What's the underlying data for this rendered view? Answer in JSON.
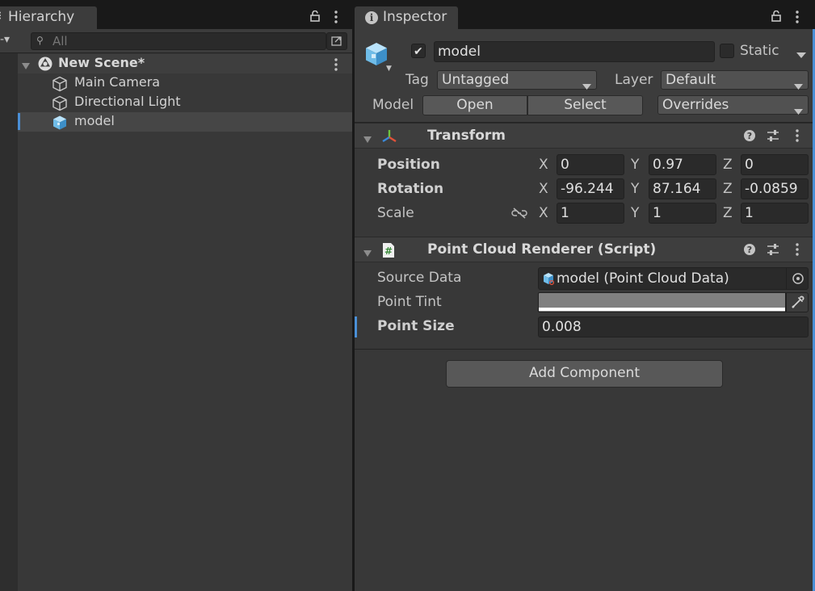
{
  "hierarchy": {
    "tab_label": "Hierarchy",
    "search_placeholder": "All",
    "scene": {
      "name": "New Scene*"
    },
    "objects": [
      {
        "label": "Main Camera",
        "icon": "gameobject-icon"
      },
      {
        "label": "Directional Light",
        "icon": "gameobject-icon"
      },
      {
        "label": "model",
        "icon": "prefab-model-icon",
        "selected": true
      }
    ]
  },
  "inspector": {
    "tab_label": "Inspector",
    "gameobject": {
      "active": true,
      "name": "model",
      "static_label": "Static",
      "static": false,
      "tag_label": "Tag",
      "tag_value": "Untagged",
      "layer_label": "Layer",
      "layer_value": "Default",
      "model_label": "Model",
      "open_label": "Open",
      "select_label": "Select",
      "overrides_label": "Overrides"
    },
    "transform": {
      "title": "Transform",
      "position_label": "Position",
      "rotation_label": "Rotation",
      "scale_label": "Scale",
      "axis_x": "X",
      "axis_y": "Y",
      "axis_z": "Z",
      "position": {
        "x": "0",
        "y": "0.97",
        "z": "0"
      },
      "rotation": {
        "x": "-96.244",
        "y": "87.164",
        "z": "-0.0859"
      },
      "scale": {
        "x": "1",
        "y": "1",
        "z": "1"
      }
    },
    "point_cloud_renderer": {
      "title": "Point Cloud Renderer (Script)",
      "source_data_label": "Source Data",
      "source_data_value": "model (Point Cloud Data)",
      "point_tint_label": "Point Tint",
      "point_tint_color": "#808080",
      "point_size_label": "Point Size",
      "point_size_value": "0.008"
    },
    "add_component_label": "Add Component"
  },
  "colors": {
    "accent": "#4a8fd6",
    "panel_bg": "#383838",
    "field_bg": "#2a2a2a",
    "tab_bar": "#191919"
  }
}
